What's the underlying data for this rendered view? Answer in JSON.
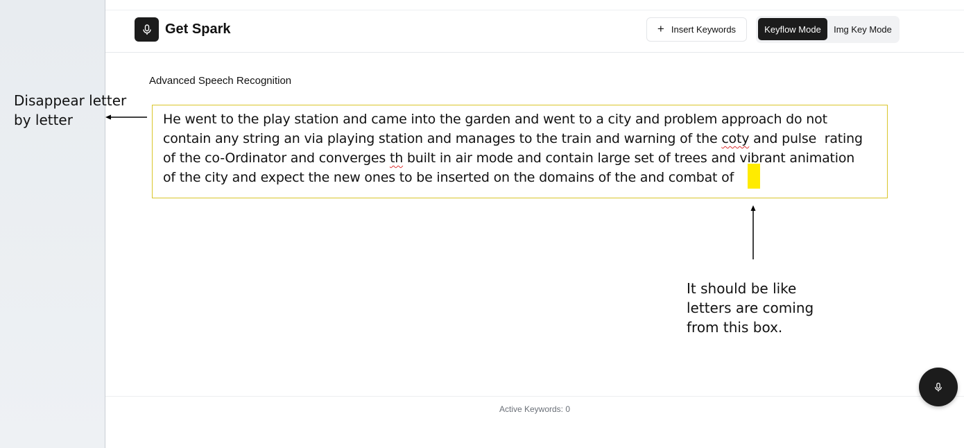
{
  "header": {
    "title": "Get Spark",
    "logo_icon": "microphone-icon",
    "insert_keywords_label": "Insert Keywords",
    "modes": [
      {
        "label": "Keyflow Mode",
        "active": true
      },
      {
        "label": "Img Key Mode",
        "active": false
      }
    ]
  },
  "main": {
    "section_label": "Advanced Speech Recognition",
    "transcript": {
      "line1": "He went to the play station and came into the garden and went to a city and problem approach do not",
      "line2_a": "contain any string an via playing station and manages to the train and warning of the ",
      "line2_b": "coty",
      "line2_c": " and pulse  rating",
      "line3_a": "of the co-Ordinator and converges ",
      "line3_b": "th",
      "line3_c": " built in air mode and contain large set of trees and vibrant animation",
      "line4": "of the city and expect the new ones to be inserted on the domains of the and combat of"
    }
  },
  "annotations": {
    "left": "Disappear letter by letter",
    "right": "It should be like letters are coming from this box."
  },
  "footer": {
    "active_keywords": "Active Keywords: 0"
  },
  "colors": {
    "accent_dark": "#1c1c1c",
    "box_border": "#d9c52a",
    "cursor_highlight": "#ffeb00"
  }
}
